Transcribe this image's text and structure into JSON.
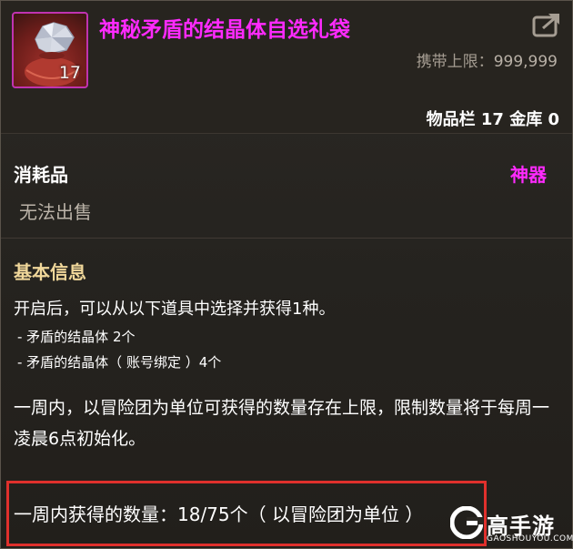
{
  "item": {
    "title": "神秘矛盾的结晶体自选礼袋",
    "stack_count": "17",
    "carry_label": "携带上限：",
    "carry_value": "999,999",
    "inventory_text": "物品栏 17 金库 0"
  },
  "category": {
    "type": "消耗品",
    "rarity": "神器",
    "sell": "无法出售"
  },
  "basic_info": {
    "title": "基本信息",
    "line1": "开启后，可以从以下道具中选择并获得1种。",
    "option1": "- 矛盾的结晶体 2个",
    "option2": "- 矛盾的结晶体（ 账号绑定 ）4个",
    "paragraph": "一周内，以冒险团为单位可获得的数量存在上限，限制数量将于每周一凌晨6点初始化。"
  },
  "weekly": {
    "text": "一周内获得的数量：18/75个（ 以冒险团为单位 ）"
  },
  "watermark": {
    "name": "高手游",
    "domain": "GAOSHOUYOU.COM"
  },
  "colors": {
    "rarity": "#ff2aff",
    "highlight_box": "#e0302c",
    "section_title": "#f0d79a"
  },
  "icons": {
    "item": "gift-bag-crystal-icon",
    "share": "share-export-icon",
    "logo": "gaoshouyou-logo-icon"
  }
}
